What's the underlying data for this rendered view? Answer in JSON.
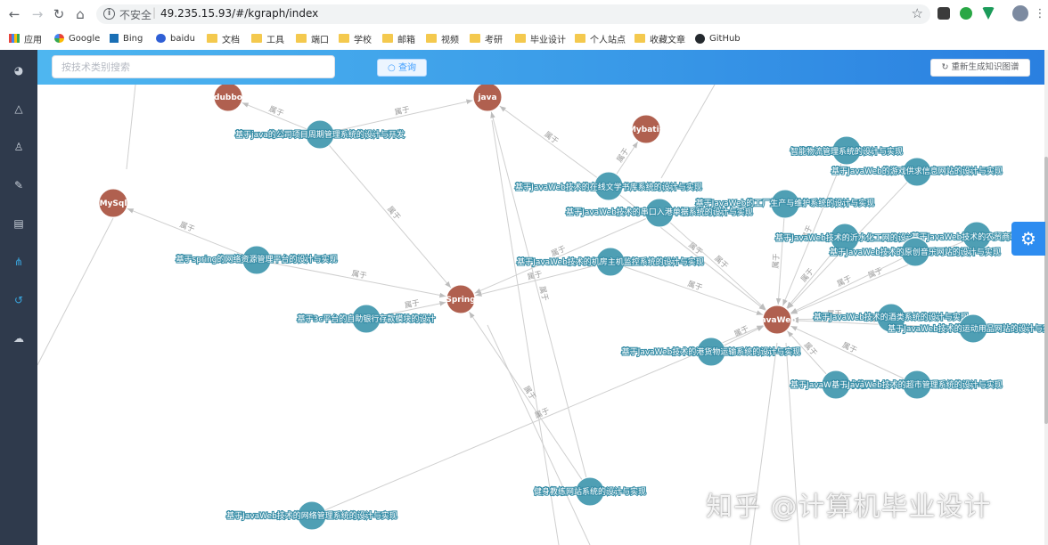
{
  "browser": {
    "insecure_label": "不安全",
    "url": "49.235.15.93/#/kgraph/index",
    "bookmarks": [
      {
        "label": "应用",
        "icon": "apps-icon"
      },
      {
        "label": "Google",
        "icon": "google-icon"
      },
      {
        "label": "Bing",
        "icon": "bing-icon"
      },
      {
        "label": "baidu",
        "icon": "baidu-icon"
      },
      {
        "label": "文档",
        "icon": "folder-icon"
      },
      {
        "label": "工具",
        "icon": "folder-icon"
      },
      {
        "label": "端口",
        "icon": "folder-icon"
      },
      {
        "label": "学校",
        "icon": "folder-icon"
      },
      {
        "label": "邮箱",
        "icon": "folder-icon"
      },
      {
        "label": "视频",
        "icon": "folder-icon"
      },
      {
        "label": "考研",
        "icon": "folder-icon"
      },
      {
        "label": "毕业设计",
        "icon": "folder-icon"
      },
      {
        "label": "个人站点",
        "icon": "folder-icon"
      },
      {
        "label": "收藏文章",
        "icon": "folder-icon"
      },
      {
        "label": "GitHub",
        "icon": "github-icon"
      }
    ]
  },
  "sidebar": {
    "icons": [
      "dashboard-icon",
      "bell-icon",
      "user-icon",
      "edit-icon",
      "document-icon",
      "graph-icon",
      "refresh-icon",
      "cloud-icon"
    ],
    "active_index": 5
  },
  "toolbar": {
    "search_placeholder": "按技术类别搜索",
    "query_label": "查询",
    "regenerate_label": "重新生成知识图谱"
  },
  "graph": {
    "relation_label": "属于",
    "colors": {
      "tech_node": "#b0604f",
      "project_node": "#4f9fb4",
      "edge": "#cfcfcf",
      "edge_label": "#9a9a9a"
    },
    "tech_nodes": [
      {
        "id": "dubbo",
        "label": "dubbo"
      },
      {
        "id": "java",
        "label": "java"
      },
      {
        "id": "mybatis",
        "label": "Mybatis"
      },
      {
        "id": "mysql",
        "label": "MySql"
      },
      {
        "id": "spring",
        "label": "Spring"
      },
      {
        "id": "javaweb",
        "label": "JavaWeb"
      }
    ],
    "project_nodes": [
      {
        "id": "p1",
        "label": "基于java的公司项目周期管理系统的设计与开发"
      },
      {
        "id": "p2",
        "label": "基于spring的网络资源管理平台的设计与实现"
      },
      {
        "id": "p3",
        "label": "基于3c平台的自助银行存款模块的设计"
      },
      {
        "id": "p4",
        "label": "基于JavaWeb技术的在线文学书库系统的设计与实现"
      },
      {
        "id": "p5",
        "label": "基于JavaWeb技术的串口入港单据系统的设计与实现"
      },
      {
        "id": "p6",
        "label": "基于JavaWeb技术的机房主机监控系统的设计与实现"
      },
      {
        "id": "p7",
        "label": "智能物流管理系统的设计与实现"
      },
      {
        "id": "p8",
        "label": "基于JavaWeb的游戏供求信息网站的设计与实现"
      },
      {
        "id": "p9",
        "label": "基于JavaWeb的工厂生产与维护系统的设计与实现"
      },
      {
        "id": "p10",
        "label": "基于JavaWeb技术的沂水化工网的设计"
      },
      {
        "id": "p11",
        "label": "基于JavaWeb技术的农贸商城的设计"
      },
      {
        "id": "p12",
        "label": "基于JavaWeb技术的原创音乐网站的设计与实现"
      },
      {
        "id": "p13",
        "label": "基于JavaWeb技术的酒类系统的设计与实现"
      },
      {
        "id": "p14",
        "label": "基于JavaWeb技术的运动用品网站的设计与实现"
      },
      {
        "id": "p15",
        "label": "基于JavaWeb技术的港货物运输系统的设计与实现"
      },
      {
        "id": "p16",
        "label": "基于JavaWeb技术的网上"
      },
      {
        "id": "p17",
        "label": "基于JavaWeb技术的超市管理系统的设计与实现"
      },
      {
        "id": "p18",
        "label": "健身教练网站系统的设计与实现"
      },
      {
        "id": "p19",
        "label": "基于JavaWeb技术的网络管理系统的设计与实现"
      }
    ],
    "edges": [
      [
        "p1",
        "dubbo"
      ],
      [
        "p1",
        "java"
      ],
      [
        "p1",
        "spring"
      ],
      [
        "p2",
        "mysql"
      ],
      [
        "p2",
        "spring"
      ],
      [
        "p3",
        "spring"
      ],
      [
        "p4",
        "java"
      ],
      [
        "p4",
        "mybatis"
      ],
      [
        "p4",
        "javaweb"
      ],
      [
        "p5",
        "spring"
      ],
      [
        "p5",
        "javaweb"
      ],
      [
        "p6",
        "spring"
      ],
      [
        "p6",
        "javaweb"
      ],
      [
        "p7",
        "javaweb"
      ],
      [
        "p8",
        "javaweb"
      ],
      [
        "p9",
        "javaweb"
      ],
      [
        "p10",
        "javaweb"
      ],
      [
        "p11",
        "javaweb"
      ],
      [
        "p12",
        "javaweb"
      ],
      [
        "p13",
        "javaweb"
      ],
      [
        "p14",
        "javaweb"
      ],
      [
        "p15",
        "javaweb"
      ],
      [
        "p16",
        "javaweb"
      ],
      [
        "p17",
        "javaweb"
      ],
      [
        "p18",
        "java"
      ],
      [
        "p18",
        "spring"
      ],
      [
        "p19",
        "javaweb"
      ]
    ]
  },
  "watermark": "知乎 @计算机毕业设计"
}
